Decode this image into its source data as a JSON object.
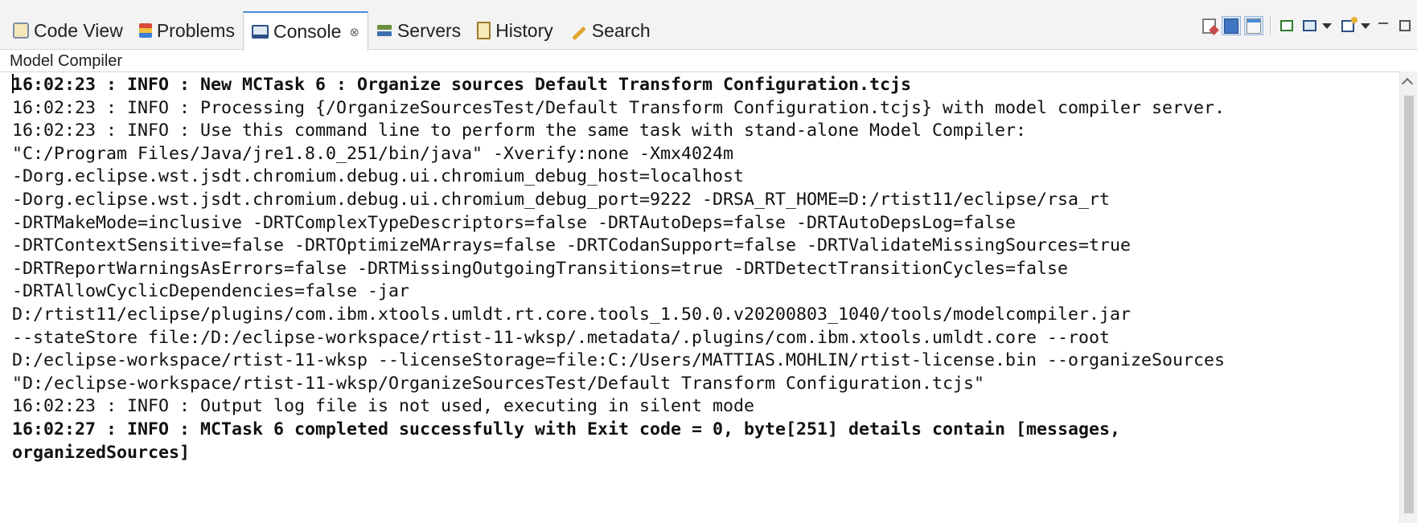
{
  "tabs": [
    {
      "label": "Code View",
      "icon": "code-view-icon"
    },
    {
      "label": "Problems",
      "icon": "problems-icon"
    },
    {
      "label": "Console",
      "icon": "console-icon",
      "active": true,
      "close": "⊗"
    },
    {
      "label": "Servers",
      "icon": "servers-icon"
    },
    {
      "label": "History",
      "icon": "history-icon"
    },
    {
      "label": "Search",
      "icon": "search-icon"
    }
  ],
  "toolbar": {
    "icons": [
      "clear-console-icon",
      "scroll-lock-icon",
      "word-wrap-icon",
      "pin-console-icon",
      "display-console-icon",
      "open-console-icon",
      "minimize-icon",
      "maximize-icon"
    ]
  },
  "console": {
    "name": "Model Compiler",
    "lines": [
      {
        "text": "16:02:23 : INFO : New MCTask 6 : Organize sources Default Transform Configuration.tcjs",
        "bold": true
      },
      {
        "text": "16:02:23 : INFO : Processing {/OrganizeSourcesTest/Default Transform Configuration.tcjs} with model compiler server.",
        "bold": false
      },
      {
        "text": "16:02:23 : INFO : Use this command line to perform the same task with stand-alone Model Compiler:",
        "bold": false
      },
      {
        "text": "\"C:/Program Files/Java/jre1.8.0_251/bin/java\" -Xverify:none -Xmx4024m",
        "bold": false
      },
      {
        "text": "-Dorg.eclipse.wst.jsdt.chromium.debug.ui.chromium_debug_host=localhost",
        "bold": false
      },
      {
        "text": "-Dorg.eclipse.wst.jsdt.chromium.debug.ui.chromium_debug_port=9222 -DRSA_RT_HOME=D:/rtist11/eclipse/rsa_rt",
        "bold": false
      },
      {
        "text": "-DRTMakeMode=inclusive -DRTComplexTypeDescriptors=false -DRTAutoDeps=false -DRTAutoDepsLog=false",
        "bold": false
      },
      {
        "text": "-DRTContextSensitive=false -DRTOptimizeMArrays=false -DRTCodanSupport=false -DRTValidateMissingSources=true",
        "bold": false
      },
      {
        "text": "-DRTReportWarningsAsErrors=false -DRTMissingOutgoingTransitions=true -DRTDetectTransitionCycles=false",
        "bold": false
      },
      {
        "text": "-DRTAllowCyclicDependencies=false -jar",
        "bold": false
      },
      {
        "text": "D:/rtist11/eclipse/plugins/com.ibm.xtools.umldt.rt.core.tools_1.50.0.v20200803_1040/tools/modelcompiler.jar",
        "bold": false
      },
      {
        "text": "--stateStore file:/D:/eclipse-workspace/rtist-11-wksp/.metadata/.plugins/com.ibm.xtools.umldt.core --root",
        "bold": false
      },
      {
        "text": "D:/eclipse-workspace/rtist-11-wksp --licenseStorage=file:C:/Users/MATTIAS.MOHLIN/rtist-license.bin --organizeSources",
        "bold": false
      },
      {
        "text": "\"D:/eclipse-workspace/rtist-11-wksp/OrganizeSourcesTest/Default Transform Configuration.tcjs\"",
        "bold": false
      },
      {
        "text": "16:02:23 : INFO : Output log file is not used, executing in silent mode",
        "bold": false
      },
      {
        "text": "16:02:27 : INFO : MCTask 6 completed successfully with Exit code = 0, byte[251] details contain [messages,",
        "bold": true
      },
      {
        "text": "organizedSources]",
        "bold": true
      }
    ]
  },
  "colors": {
    "active_tab_accent": "#4a8ad6",
    "tab_bar_bg": "#f3f3f3",
    "output_text": "#111111"
  }
}
